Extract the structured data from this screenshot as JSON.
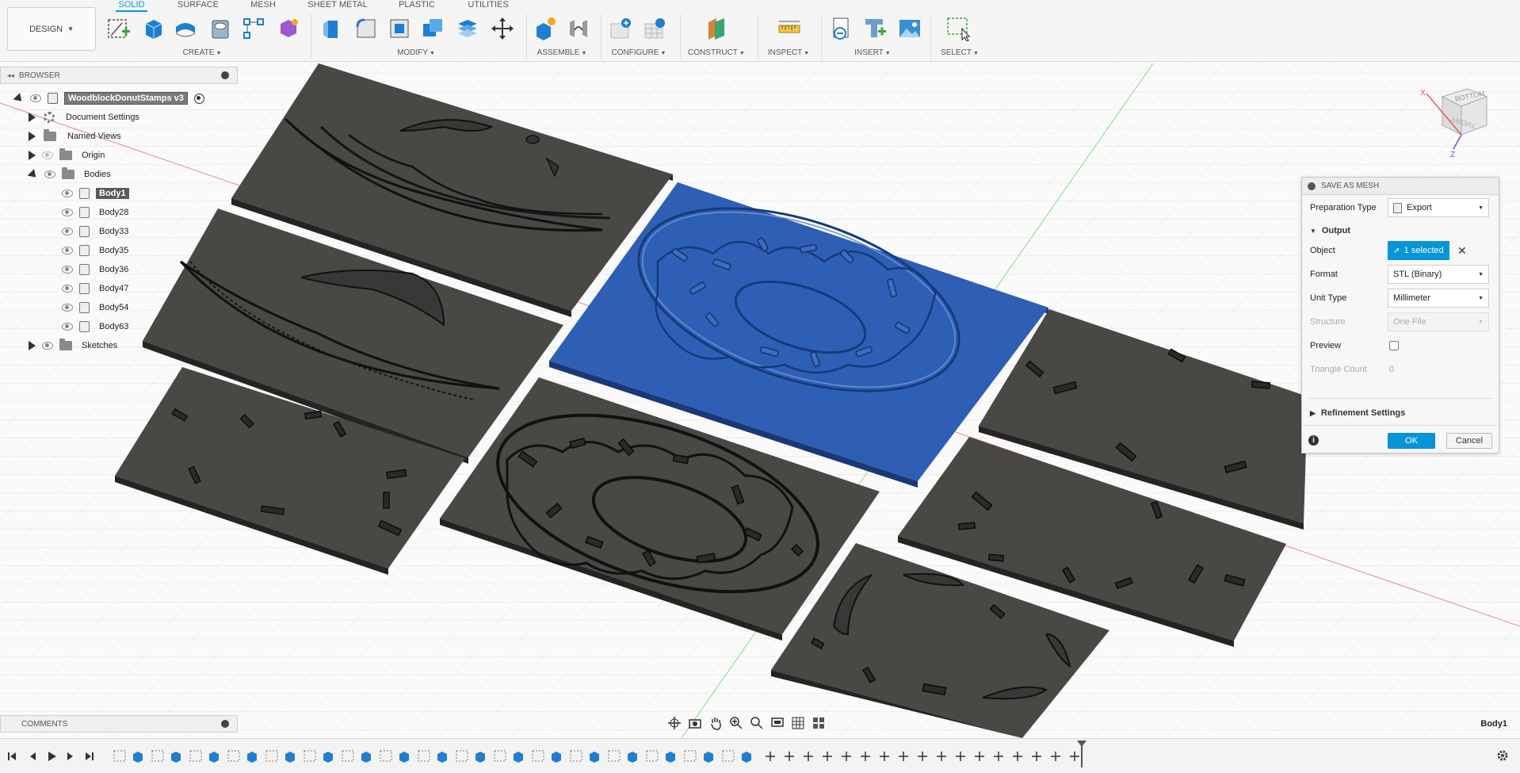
{
  "workspace": {
    "label": "DESIGN"
  },
  "tabs": [
    "SOLID",
    "SURFACE",
    "MESH",
    "SHEET METAL",
    "PLASTIC",
    "UTILITIES"
  ],
  "groups": [
    "CREATE",
    "MODIFY",
    "ASSEMBLE",
    "CONFIGURE",
    "CONSTRUCT",
    "INSPECT",
    "INSERT",
    "SELECT"
  ],
  "browser": {
    "title": "BROWSER",
    "root": "WoodblockDonutStamps v3",
    "items": {
      "document_settings": "Document Settings",
      "named_views": "Named Views",
      "origin": "Origin",
      "bodies": "Bodies",
      "sketches": "Sketches"
    },
    "bodies": [
      "Body1",
      "Body28",
      "Body33",
      "Body35",
      "Body36",
      "Body47",
      "Body54",
      "Body63"
    ]
  },
  "viewcube": {
    "top_face": "BOTTOM",
    "front_face": "FRONT",
    "axis_x": "X",
    "axis_z": "Z"
  },
  "dialog": {
    "title": "SAVE AS MESH",
    "preparation_type_label": "Preparation Type",
    "preparation_type_value": "Export",
    "output_section": "Output",
    "object_label": "Object",
    "object_value": "1 selected",
    "format_label": "Format",
    "format_value": "STL (Binary)",
    "unit_type_label": "Unit Type",
    "unit_type_value": "Millimeter",
    "structure_label": "Structure",
    "structure_value": "One File",
    "preview_label": "Preview",
    "preview_checked": false,
    "triangle_count_label": "Triangle Count",
    "triangle_count_value": "0",
    "refinement_section": "Refinement Settings",
    "ok_label": "OK",
    "cancel_label": "Cancel"
  },
  "comments": {
    "title": "COMMENTS"
  },
  "selection_name": "Body1",
  "colors": {
    "accent": "#0696d7",
    "selected_body": "#2f5fb5",
    "plate": "#4a4845"
  }
}
